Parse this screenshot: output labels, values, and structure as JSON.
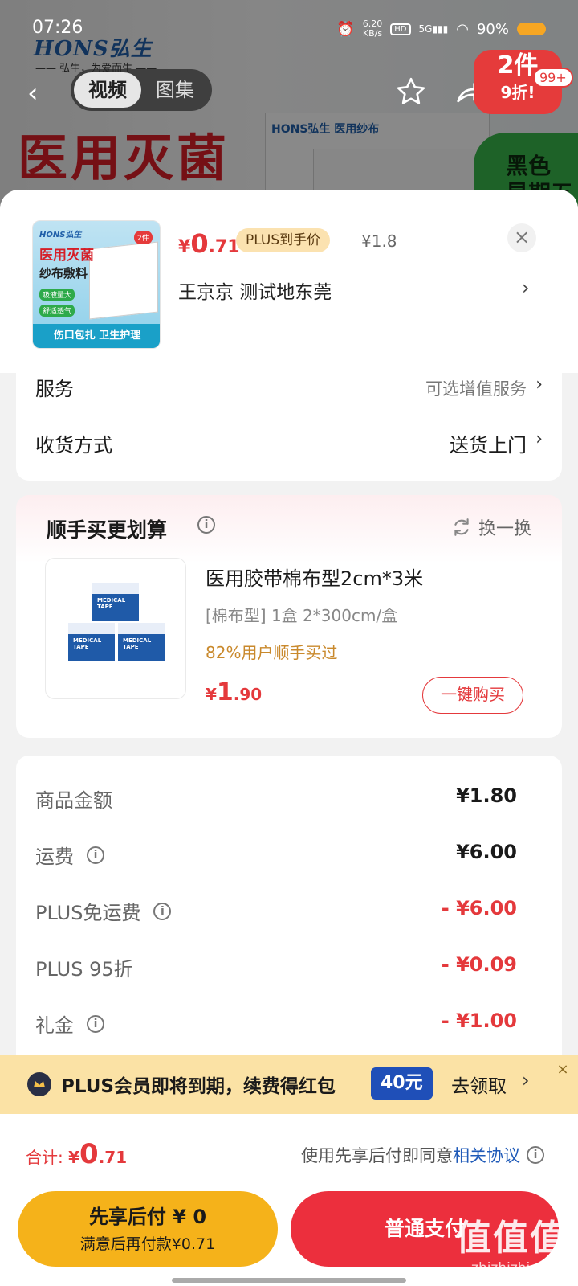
{
  "status_bar": {
    "time": "07:26",
    "speed_value": "6.20",
    "speed_unit": "KB/s",
    "hd": "HD",
    "net": "5G",
    "battery": "90%"
  },
  "background": {
    "brand": "HONS弘生",
    "slogan": "—— 弘生，为爱而生 ——",
    "big_title": "医用灭菌",
    "box_label": "HONS弘生 医用纱布",
    "green_text": "黑色\n星期五"
  },
  "top_nav": {
    "tabs": [
      "视频",
      "图集"
    ],
    "active_tab": 0,
    "promo_line1": "2件",
    "promo_line2": "9折!",
    "cart_count": "99+"
  },
  "product": {
    "thumb": {
      "brand": "HONS弘生",
      "title1": "医用灭菌",
      "title2": "纱布敷料",
      "chip1": "吸液量大",
      "chip2": "舒适透气",
      "bottom": "伤口包扎 卫生护理",
      "tag": "2件"
    },
    "price_currency": "¥",
    "price_int": "0",
    "price_dec": ".71",
    "plus_tag": "PLUS到手价",
    "orig_price": "¥1.8",
    "address": "王京京  测试地东莞"
  },
  "service": {
    "rows": [
      {
        "label": "服务",
        "value": "可选增值服务"
      },
      {
        "label": "收货方式",
        "value": "送货上门"
      }
    ]
  },
  "recommend": {
    "title": "顺手买更划算",
    "refresh": "换一换",
    "item": {
      "name": "医用胶带棉布型2cm*3米",
      "spec": "[棉布型] 1盒 2*300cm/盒",
      "pct": "82%用户顺手买过",
      "price_currency": "¥",
      "price_int": "1",
      "price_dec": ".90",
      "buy": "一键购买",
      "box_text": "MEDICAL TAPE"
    }
  },
  "summary": {
    "rows": [
      {
        "label": "商品金额",
        "value": "¥1.80",
        "info": false,
        "red": false
      },
      {
        "label": "运费",
        "value": "¥6.00",
        "info": true,
        "red": false
      },
      {
        "label": "PLUS免运费",
        "value": "- ¥6.00",
        "info": true,
        "red": true
      },
      {
        "label": "PLUS 95折",
        "value": "- ¥0.09",
        "info": false,
        "red": true
      },
      {
        "label": "礼金",
        "value": "- ¥1.00",
        "info": true,
        "red": true
      }
    ]
  },
  "plus_banner": {
    "text": "PLUS会员即将到期，续费得红包",
    "amount": "40元",
    "action": "去领取"
  },
  "checkout": {
    "total_label": "合计: ",
    "total_currency": "¥",
    "total_int": "0",
    "total_dec": ".71",
    "agree_text": "使用先享后付即同意",
    "agree_link": "相关协议",
    "later_line1": "先享后付 ¥ 0",
    "later_line2": "满意后再付款¥0.71",
    "pay_label": "普通支付"
  },
  "watermark": {
    "main": "值值值",
    "url": "zhizhizhi.com"
  },
  "colors": {
    "accent_red": "#e4393c",
    "plus_gold": "#fbe2a5",
    "pay_red": "#ec2f3d",
    "later_yellow": "#f5b21a",
    "link_blue": "#1f5ab8"
  }
}
